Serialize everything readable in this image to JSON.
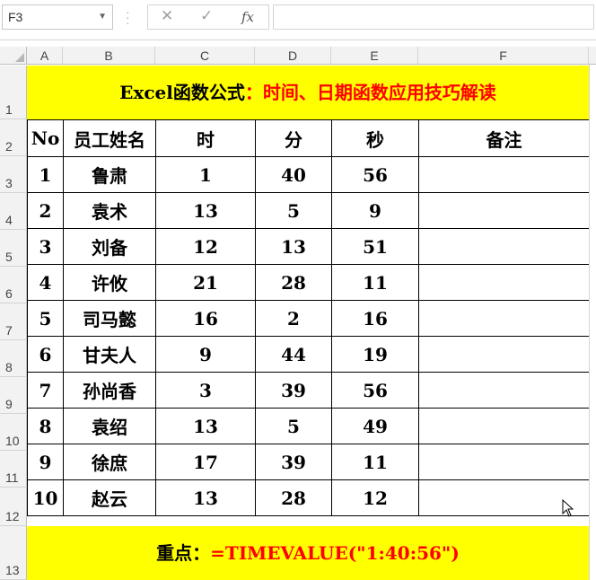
{
  "formula_bar": {
    "name_box": "F3",
    "cancel_glyph": "✕",
    "enter_glyph": "✓",
    "fx_label": "fx",
    "formula": ""
  },
  "columns": [
    "A",
    "B",
    "C",
    "D",
    "E",
    "F"
  ],
  "rows": [
    "1",
    "2",
    "3",
    "4",
    "5",
    "6",
    "7",
    "8",
    "9",
    "10",
    "11",
    "12",
    "13"
  ],
  "title": {
    "black": "Excel函数公式",
    "red": "：时间、日期函数应用技巧解读"
  },
  "table": {
    "headers": [
      "No",
      "员工姓名",
      "时",
      "分",
      "秒",
      "备注"
    ],
    "rows": [
      [
        "1",
        "鲁肃",
        "1",
        "40",
        "56",
        ""
      ],
      [
        "2",
        "袁术",
        "13",
        "5",
        "9",
        ""
      ],
      [
        "3",
        "刘备",
        "12",
        "13",
        "51",
        ""
      ],
      [
        "4",
        "许攸",
        "21",
        "28",
        "11",
        ""
      ],
      [
        "5",
        "司马懿",
        "16",
        "2",
        "16",
        ""
      ],
      [
        "6",
        "甘夫人",
        "9",
        "44",
        "19",
        ""
      ],
      [
        "7",
        "孙尚香",
        "3",
        "39",
        "56",
        ""
      ],
      [
        "8",
        "袁绍",
        "13",
        "5",
        "49",
        ""
      ],
      [
        "9",
        "徐庶",
        "17",
        "39",
        "11",
        ""
      ],
      [
        "10",
        "赵云",
        "13",
        "28",
        "12",
        ""
      ]
    ]
  },
  "key_point": {
    "label": "重点：",
    "formula": "=TIMEVALUE(\"1:40:56\")"
  },
  "colors": {
    "band": "#ffff00",
    "accent_red": "#ff0000"
  }
}
